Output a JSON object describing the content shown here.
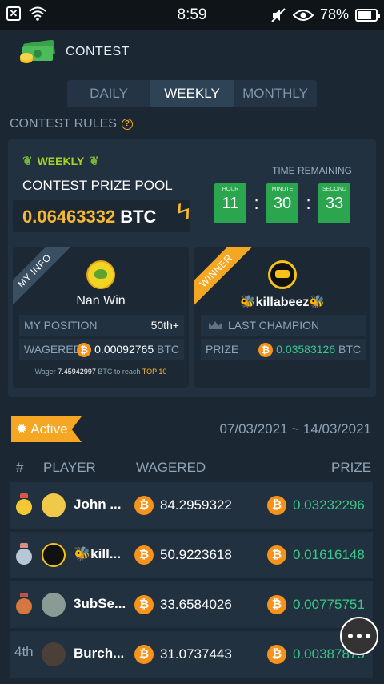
{
  "status_bar": {
    "time": "8:59",
    "battery": "78%",
    "battery_level": 0.78
  },
  "header": {
    "title": "CONTEST"
  },
  "tabs": [
    {
      "label": "DAILY",
      "active": false
    },
    {
      "label": "WEEKLY",
      "active": true
    },
    {
      "label": "MONTHLY",
      "active": false
    }
  ],
  "rules": {
    "label": "CONTEST RULES"
  },
  "prize": {
    "weekly_label": "WEEKLY",
    "title": "CONTEST PRIZE POOL",
    "amount": "0.06463332",
    "currency": "BTC",
    "time_remaining_label": "TIME REMAINING",
    "timer": [
      {
        "label": "HOUR",
        "value": "11"
      },
      {
        "label": "MINUTE",
        "value": "30"
      },
      {
        "label": "SECOND",
        "value": "33"
      }
    ]
  },
  "my_info": {
    "ribbon": "MY INFO",
    "name": "Nan Win",
    "position_label": "MY POSITION",
    "position_value": "50th+",
    "wagered_label": "WAGERED",
    "wagered_value": "0.00092765",
    "wagered_unit": "BTC",
    "note_prefix": "Wager",
    "note_amount": "7.45942997",
    "note_middle": "BTC to reach",
    "note_target": "TOP 10"
  },
  "winner": {
    "ribbon": "WINNER",
    "name": "🐝killabeez🐝",
    "last_champion_label": "LAST CHAMPION",
    "prize_label": "PRIZE",
    "prize_value": "0.03583126",
    "prize_unit": "BTC"
  },
  "leaderboard": {
    "status": "Active",
    "date_range": "07/03/2021 ~ 14/03/2021",
    "columns": {
      "rank": "#",
      "player": "PLAYER",
      "wagered": "WAGERED",
      "prize": "PRIZE"
    },
    "rows": [
      {
        "rank": "",
        "medal": "gold",
        "player": "John ...",
        "wagered": "84.2959322",
        "prize": "0.03232296"
      },
      {
        "rank": "",
        "medal": "silver",
        "player": "🐝kill...",
        "wagered": "50.9223618",
        "prize": "0.01616148"
      },
      {
        "rank": "",
        "medal": "bronze",
        "player": "3ubSe...",
        "wagered": "33.6584026",
        "prize": "0.00775751"
      },
      {
        "rank": "4th",
        "medal": "",
        "player": "Burch...",
        "wagered": "31.0737443",
        "prize": "0.00387875"
      }
    ]
  }
}
